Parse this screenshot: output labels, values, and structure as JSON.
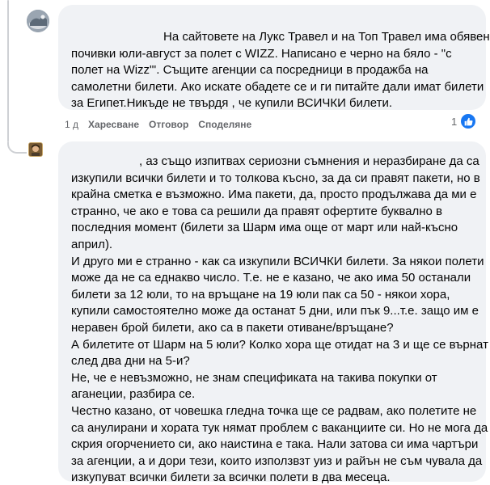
{
  "comment1": {
    "text_lines": [
      "На сайтовете на Лукс Травел и на Топ Травел има обявени",
      "почивки юли-август за полет с WIZZ. Написано е черно на бяло - \"с",
      "полет на Wizz\"'. Същите агенции са посредници в продажба на",
      "самолетни билети. Ако искате обадете се и ги питайте дали имат билети",
      "за Египет.Никъде не твърдя , че купили ВСИЧКИ билети."
    ],
    "time": "1 д",
    "like_label": "Харесване",
    "reply_label": "Отговор",
    "share_label": "Споделяне",
    "reaction_count": "1",
    "reaction_icon": "like-icon",
    "reaction_color": "#1877f2"
  },
  "comment2": {
    "text_lines": [
      ", аз също изпитвах сериозни съмнения и неразбиране да са",
      "изкупили всички билети и то толкова късно, за да си правят пакети, но в",
      "крайна сметка е възможно. Има пакети, да, просто продължава да ми е",
      "странно, че ако е това са решили да правят офертите буквално в",
      "последния момент (билети за Шарм има още от март или най-късно",
      "април).",
      "И друго ми е странно - как са изкупили ВСИЧКИ билети. За някои полети",
      "може да не са еднакво число. Т.е. не е казано, че ако има 50 останали",
      "билети за 12 юли, то на връщане на 19 юли пак са 50 - някои хора,",
      "купили самостоятелно може да останат 5 дни, или пък 9...т.е. защо им е",
      "неравен брой билети, ако са в пакети отиване/връщане?",
      "А билетите от Шарм на 5 юли? Колко хора ще отидат на 3 и ще се върнат",
      "след два дни на 5-и?",
      "Не, че е невъзможно, не знам спецификата на такива покупки от",
      "аганеции, разбира се.",
      "Честно казано, от човешка гледна точка ще се радвам, ако полетите не",
      "са анулирани и хората тук нямат проблем с ваканциите си. Но не мога да",
      "скрия огорчението си, ако наистина е така. Нали затова си има чартъри",
      "за агенции, а и дори тези, които използвзт уиз и райън не съм чувала да",
      "изкупуват всички билети за всички полети в два месеца."
    ]
  }
}
